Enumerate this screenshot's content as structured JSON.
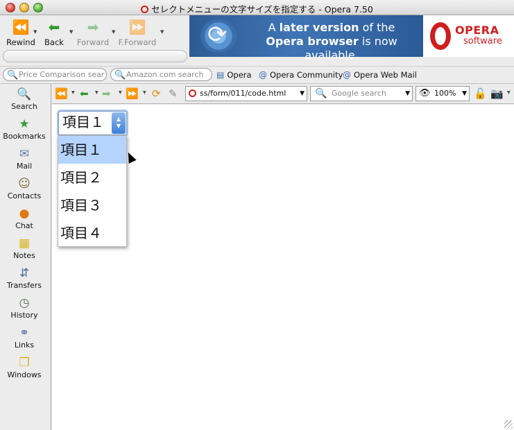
{
  "window": {
    "title": "セレクトメニューの文字サイズを指定する - Opera 7.50"
  },
  "nav": {
    "rewind": "Rewind",
    "back": "Back",
    "forward": "Forward",
    "fforward": "F.Forward"
  },
  "banner": {
    "line1_pre": "A ",
    "line1_bold": "later version",
    "line1_post": " of the",
    "line2_bold": "Opera browser",
    "line2_post": " is now available.",
    "logo_name": "OPERA",
    "logo_sub": "software"
  },
  "personal": {
    "price_search_placeholder": "Price Comparison sear",
    "amazon_search_placeholder": "Amazon.com search",
    "links": [
      "Opera",
      "Opera Community",
      "Opera Web Mail"
    ]
  },
  "panels": [
    {
      "label": "Search",
      "icon": "magnifier-icon"
    },
    {
      "label": "Bookmarks",
      "icon": "bookmarks-icon"
    },
    {
      "label": "Mail",
      "icon": "mail-icon"
    },
    {
      "label": "Contacts",
      "icon": "contacts-icon"
    },
    {
      "label": "Chat",
      "icon": "chat-icon"
    },
    {
      "label": "Notes",
      "icon": "notes-icon"
    },
    {
      "label": "Transfers",
      "icon": "transfers-icon"
    },
    {
      "label": "History",
      "icon": "history-icon"
    },
    {
      "label": "Links",
      "icon": "links-icon"
    },
    {
      "label": "Windows",
      "icon": "windows-icon"
    }
  ],
  "toolbar": {
    "address": "ss/form/011/code.html",
    "google_placeholder": "Google search",
    "zoom": "100%"
  },
  "page": {
    "select_value": "項目１",
    "options": [
      "項目１",
      "項目２",
      "項目３",
      "項目４"
    ],
    "selected_index": 0
  }
}
